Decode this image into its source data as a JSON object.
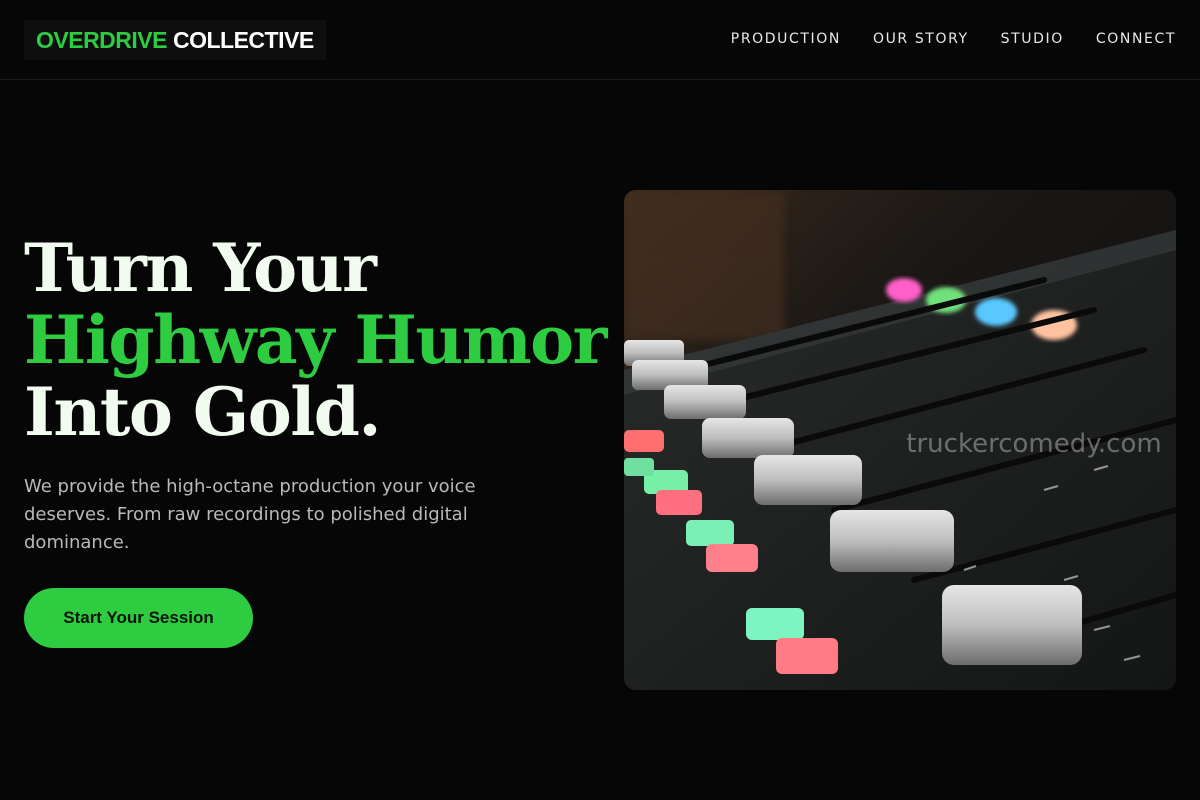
{
  "brand": {
    "name_primary": "OVERDRIVE",
    "name_secondary": "COLLECTIVE",
    "accent_color": "#2ecc40",
    "background_color": "#060606"
  },
  "nav": {
    "items": [
      {
        "label": "PRODUCTION"
      },
      {
        "label": "OUR STORY"
      },
      {
        "label": "STUDIO"
      },
      {
        "label": "CONNECT"
      }
    ]
  },
  "hero": {
    "title_line1": "Turn Your",
    "title_line2": "Highway Humor",
    "title_line3": "Into Gold.",
    "subtitle": "We provide the high-octane production your voice deserves. From raw recordings to polished digital dominance.",
    "cta_label": "Start Your Session",
    "image": {
      "subject": "mixing-console-photo",
      "watermark": "truckercomedy.com"
    }
  }
}
